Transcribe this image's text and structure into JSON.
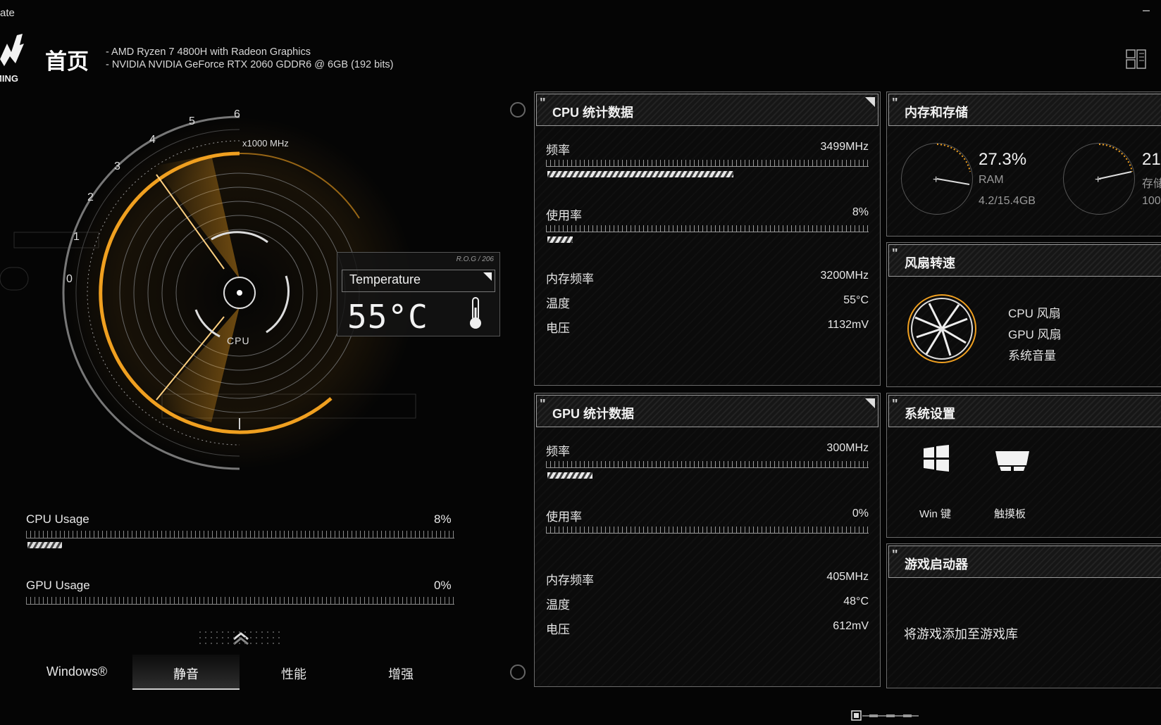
{
  "window": {
    "title_fragment": "ate",
    "minimize": "–"
  },
  "header": {
    "title": "首页",
    "cpu_line": "-  AMD Ryzen 7 4800H with Radeon Graphics",
    "gpu_line": "-  NVIDIA NVIDIA GeForce RTX 2060 GDDR6 @ 6GB (192 bits)",
    "logo_text": "MING"
  },
  "gauge": {
    "ticks": [
      "0",
      "1",
      "2",
      "3",
      "4",
      "5",
      "6"
    ],
    "unit": "x1000 MHz",
    "center_label": "CPU",
    "frequency_ghz": 3.5
  },
  "temperature": {
    "brand": "R.O.G / 206",
    "label": "Temperature",
    "value": "55°C"
  },
  "usage": {
    "cpu": {
      "label": "CPU Usage",
      "value": "8%",
      "fraction": 0.08
    },
    "gpu": {
      "label": "GPU Usage",
      "value": "0%",
      "fraction": 0.0
    }
  },
  "modes": {
    "items": [
      "Windows®",
      "静音",
      "性能",
      "增强"
    ],
    "active": "静音"
  },
  "cpu_panel": {
    "title": "CPU 统计数据",
    "freq_label": "频率",
    "freq_value": "3499MHz",
    "freq_fraction": 0.58,
    "usage_label": "使用率",
    "usage_value": "8%",
    "usage_fraction": 0.08,
    "mem_freq_label": "内存频率",
    "mem_freq_value": "3200MHz",
    "temp_label": "温度",
    "temp_value": "55°C",
    "volt_label": "电压",
    "volt_value": "1132mV"
  },
  "gpu_panel": {
    "title": "GPU 统计数据",
    "freq_label": "频率",
    "freq_value": "300MHz",
    "freq_fraction": 0.14,
    "usage_label": "使用率",
    "usage_value": "0%",
    "usage_fraction": 0.0,
    "mem_freq_label": "内存频率",
    "mem_freq_value": "405MHz",
    "temp_label": "温度",
    "temp_value": "48°C",
    "volt_label": "电压",
    "volt_value": "612mV"
  },
  "memory_panel": {
    "title": "内存和存储",
    "ram_pct": "27.3%",
    "ram_label": "RAM",
    "ram_detail": "4.2/15.4GB",
    "storage_pct": "21",
    "storage_label": "存储",
    "storage_detail": "100"
  },
  "fan_panel": {
    "title": "风扇转速",
    "items": [
      "CPU 风扇",
      "GPU 风扇",
      "系统音量"
    ]
  },
  "settings_panel": {
    "title": "系统设置",
    "win_key": "Win 键",
    "touchpad": "触摸板"
  },
  "game_panel": {
    "title": "游戏启动器",
    "empty_text": "将游戏添加至游戏库"
  },
  "colors": {
    "accent": "#f0a020",
    "background": "#050505",
    "panel_border": "#6a6a6a"
  }
}
